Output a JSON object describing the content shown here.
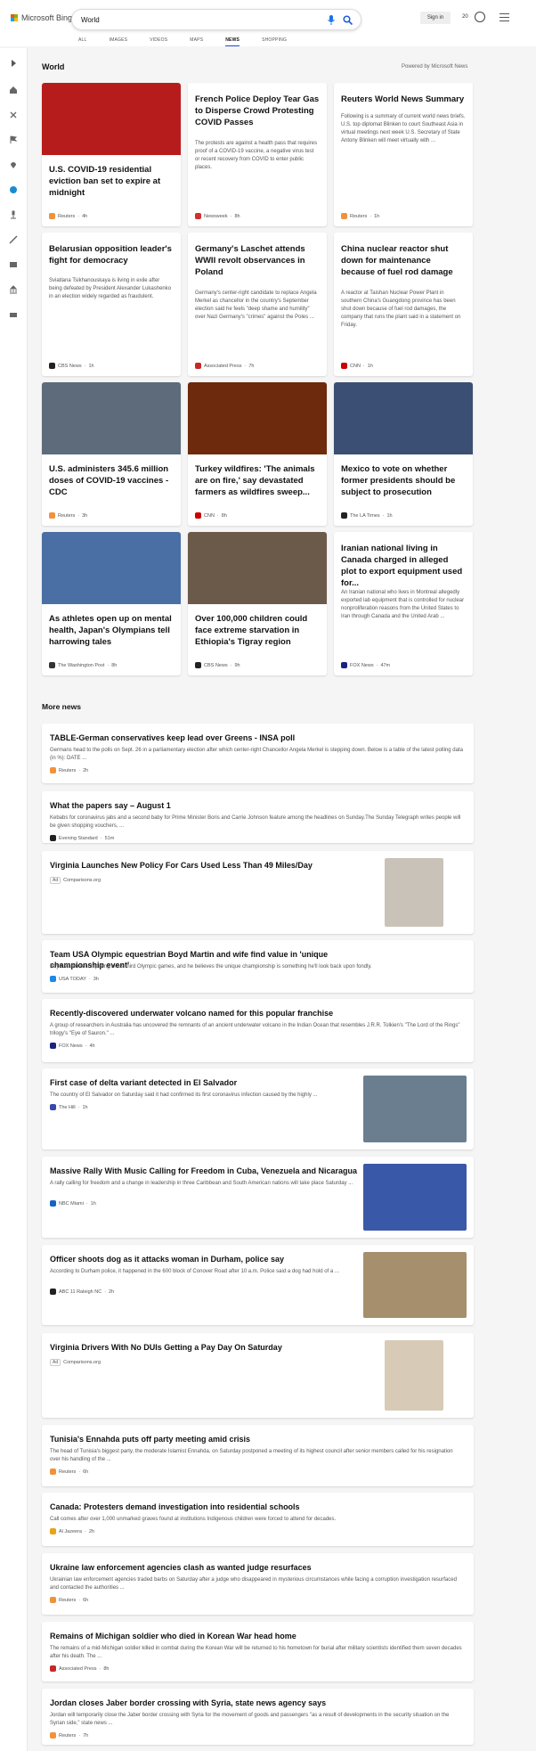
{
  "header": {
    "brand": "Microsoft Bing",
    "search_value": "World",
    "sign_in": "Sign in",
    "rewards": "20",
    "tabs": [
      "ALL",
      "IMAGES",
      "VIDEOS",
      "MAPS",
      "NEWS",
      "SHOPPING"
    ],
    "active_tab": "NEWS"
  },
  "section": {
    "title": "World",
    "powered": "Powered by Microsoft News",
    "more_title": "More news"
  },
  "cards": [
    {
      "title": "U.S. COVID-19 residential eviction ban set to expire at midnight",
      "desc": "",
      "source": "Reuters",
      "time": "4h",
      "img": "#b71c1c",
      "fav": "#f0923a"
    },
    {
      "title": "French Police Deploy Tear Gas to Disperse Crowd Protesting COVID Passes",
      "desc": "The protests are against a health pass that requires proof of a COVID-19 vaccine, a negative virus test or recent recovery from COVID to enter public places.",
      "source": "Newsweek",
      "time": "8h",
      "img": "",
      "fav": "#d32f2f"
    },
    {
      "title": "Reuters World News Summary",
      "desc": "Following is a summary of current world news briefs. U.S. top diplomat Blinken to court Southeast Asia in virtual meetings next week U.S. Secretary of State Antony Blinken will meet virtually with ...",
      "source": "Reuters",
      "time": "1h",
      "img": "",
      "fav": "#f0923a"
    },
    {
      "title": "Belarusian opposition leader's fight for democracy",
      "desc": "Sviatlana Tsikhanouskaya is living in exile after being defeated by President Alexander Lukashenko in an election widely regarded as fraudulent.",
      "source": "CBS News",
      "time": "1h",
      "img": "",
      "fav": "#222"
    },
    {
      "title": "Germany's Laschet attends WWII revolt observances in Poland",
      "desc": "Germany's center-right candidate to replace Angela Merkel as chancellor in the country's September election said he feels \"deep shame and humility\" over Nazi Germany's \"crimes\" against the Poles ...",
      "source": "Associated Press",
      "time": "7h",
      "img": "",
      "fav": "#c62828"
    },
    {
      "title": "China nuclear reactor shut down for maintenance because of fuel rod damage",
      "desc": "A reactor at Taishan Nuclear Power Plant in southern China's Guangdong province has been shut down because of fuel rod damages, the company that runs the plant said in a statement on Friday.",
      "source": "CNN",
      "time": "1h",
      "img": "",
      "fav": "#cc0000"
    },
    {
      "title": "U.S. administers 345.6 million doses of COVID-19 vaccines - CDC",
      "desc": "",
      "source": "Reuters",
      "time": "3h",
      "img": "#5d6b7a",
      "fav": "#f0923a"
    },
    {
      "title": "Turkey wildfires: 'The animals are on fire,' say devastated farmers as wildfires sweep...",
      "desc": "",
      "source": "CNN",
      "time": "8h",
      "img": "#6d2a0c",
      "fav": "#cc0000"
    },
    {
      "title": "Mexico to vote on whether former presidents should be subject to prosecution",
      "desc": "",
      "source": "The LA Times",
      "time": "1h",
      "img": "#3a4f73",
      "fav": "#222"
    },
    {
      "title": "As athletes open up on mental health, Japan's Olympians tell harrowing tales",
      "desc": "",
      "source": "The Washington Post",
      "time": "8h",
      "img": "#4a6fa5",
      "fav": "#333"
    },
    {
      "title": "Over 100,000 children could face extreme starvation in Ethiopia's Tigray region",
      "desc": "",
      "source": "CBS News",
      "time": "9h",
      "img": "#6b5a4a",
      "fav": "#222"
    },
    {
      "title": "Iranian national living in Canada charged in alleged plot to export equipment used for...",
      "desc": "An Iranian national who lives in Montreal allegedly exported lab equipment that is controlled for nuclear nonproliferation reasons from the United States to Iran through Canada and the United Arab ...",
      "source": "FOX News",
      "time": "47m",
      "img": "",
      "fav": "#1a237e"
    }
  ],
  "more": [
    {
      "title": "TABLE-German conservatives keep lead over Greens - INSA poll",
      "desc": "Germans head to the polls on Sept. 26 in a parliamentary election after which center-right Chancellor Angela Merkel is stepping down. Below is a table of the latest polling data (in %): DATE ...",
      "source": "Reuters",
      "time": "2h",
      "fav": "#f0923a",
      "thumb": ""
    },
    {
      "title": "What the papers say – August 1",
      "desc": "Kebabs for coronavirus jabs and a second baby for Prime Minister Boris and Carrie Johnson feature among the headlines on Sunday.The Sunday Telegraph writes people will be given shopping vouchers, ...",
      "source": "Evening Standard",
      "time": "51m",
      "fav": "#222",
      "thumb": ""
    },
    {
      "title": "Virginia Launches New Policy For Cars Used Less Than 49 Miles/Day",
      "desc": "",
      "source": "Comparisons.org",
      "time": "",
      "ad": "Ad",
      "fav": "",
      "thumb": "#c9c2b8"
    },
    {
      "title": "Team USA Olympic equestrian Boyd Martin and wife find value in 'unique championship event'",
      "desc": "Boyd Martin is competing in his third Olympic games, and he believes the unique championship is something he'll look back upon fondly.",
      "source": "USA TODAY",
      "time": "3h",
      "fav": "#1e88e5",
      "thumb": ""
    },
    {
      "title": "Recently-discovered underwater volcano named for this popular franchise",
      "desc": "A group of researchers in Australia has uncovered the remnants of an ancient underwater volcano in the Indian Ocean that resembles J.R.R. Tolkien's \"The Lord of the Rings\" trilogy's \"Eye of Sauron.\" ...",
      "source": "FOX News",
      "time": "4h",
      "fav": "#1a237e",
      "thumb": ""
    },
    {
      "title": "First case of delta variant detected in El Salvador",
      "desc": "The country of El Salvador on Saturday said it had confirmed its first coronavirus infection caused by the highly ...",
      "source": "The Hill",
      "time": "1h",
      "fav": "#3949ab",
      "thumb": "#6a7e90"
    },
    {
      "title": "Massive Rally With Music Calling for Freedom in Cuba, Venezuela and Nicaragua",
      "desc": "A rally calling for freedom and a change in leadership in three Caribbean and South American nations will take place Saturday ...",
      "source": "NBC Miami",
      "time": "1h",
      "fav": "#1565c0",
      "thumb": "#3a58a8"
    },
    {
      "title": "Officer shoots dog as it attacks woman in Durham, police say",
      "desc": "According to Durham police, it happened in the 600 block of Conover Road after 10 a.m. Police said a dog had hold of a ...",
      "source": "ABC 11 Raleigh NC",
      "time": "2h",
      "fav": "#222",
      "thumb": "#a58f6c"
    },
    {
      "title": "Virginia Drivers With No DUIs Getting a Pay Day On Saturday",
      "desc": "",
      "source": "Comparisons.org",
      "time": "",
      "ad": "Ad",
      "fav": "",
      "thumb": "#d7cbb8"
    },
    {
      "title": "Tunisia's Ennahda puts off party meeting amid crisis",
      "desc": "The head of Tunisia's biggest party, the moderate Islamist Ennahda, on Saturday postponed a meeting of its highest council after senior members called for his resignation over his handling of the ...",
      "source": "Reuters",
      "time": "6h",
      "fav": "#f0923a",
      "thumb": ""
    },
    {
      "title": "Canada: Protesters demand investigation into residential schools",
      "desc": "Call comes after over 1,000 unmarked graves found at institutions Indigenous children were forced to attend for decades.",
      "source": "Al Jazeera",
      "time": "2h",
      "fav": "#e8a317",
      "thumb": ""
    },
    {
      "title": "Ukraine law enforcement agencies clash as wanted judge resurfaces",
      "desc": "Ukrainian law enforcement agencies traded barbs on Saturday after a judge who disappeared in mysterious circumstances while facing a corruption investigation resurfaced and contacted the authorities ...",
      "source": "Reuters",
      "time": "6h",
      "fav": "#f0923a",
      "thumb": ""
    },
    {
      "title": "Remains of Michigan soldier who died in Korean War head home",
      "desc": "The remains of a mid-Michigan soldier killed in combat during the Korean War will be returned to his hometown for burial after military scientists identified them seven decades after his death. The ...",
      "source": "Associated Press",
      "time": "8h",
      "fav": "#c62828",
      "thumb": ""
    },
    {
      "title": "Jordan closes Jaber border crossing with Syria, state news agency says",
      "desc": "Jordan will temporarily close the Jaber border crossing with Syria for the movement of goods and passengers \"as a result of developments in the security situation on the Syrian side,\" state news ...",
      "source": "Reuters",
      "time": "7h",
      "fav": "#f0923a",
      "thumb": ""
    }
  ]
}
